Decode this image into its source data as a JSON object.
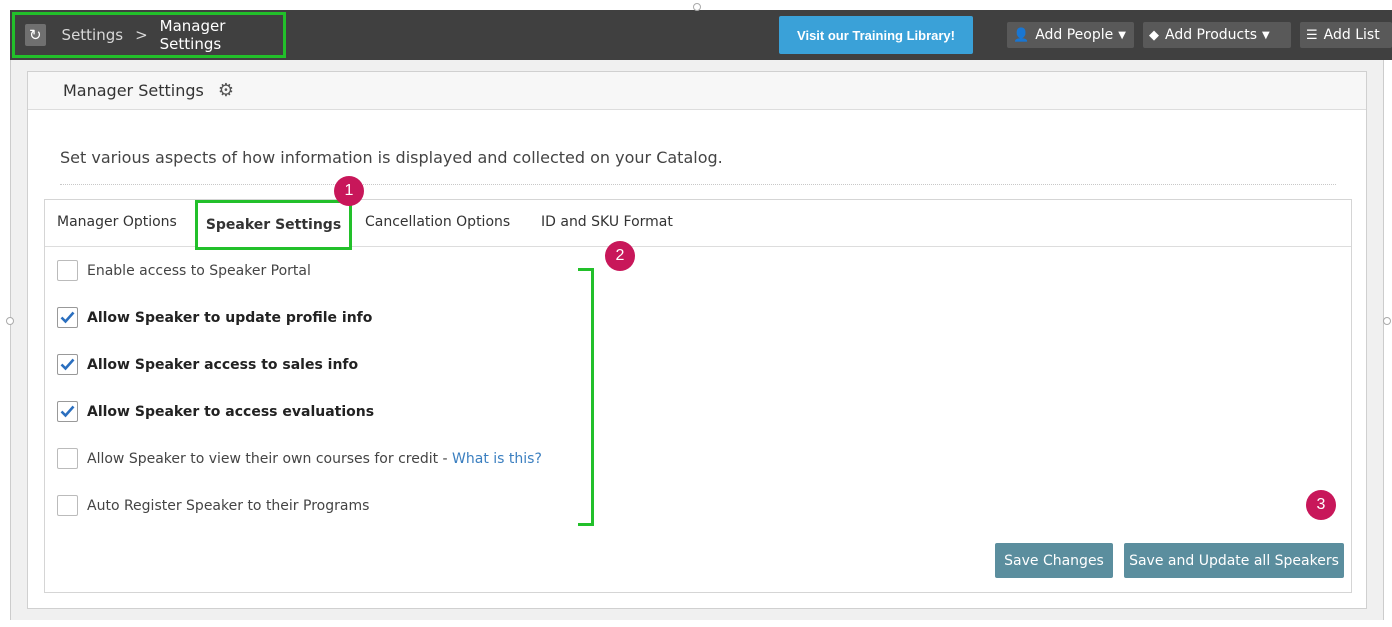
{
  "topbar": {
    "breadcrumb": {
      "refresh_icon": "refresh-icon",
      "root": "Settings",
      "separator": ">",
      "current": "Manager Settings"
    },
    "training_button": "Visit our Training Library!",
    "add_people": "Add People",
    "add_products": "Add Products",
    "add_list": "Add List"
  },
  "panel": {
    "title": "Manager Settings",
    "description": "Set various aspects of how information is displayed and collected on your Catalog."
  },
  "tabs": [
    {
      "label": "Manager Options",
      "active": false
    },
    {
      "label": "Speaker Settings",
      "active": true
    },
    {
      "label": "Cancellation Options",
      "active": false
    },
    {
      "label": "ID and SKU Format",
      "active": false
    }
  ],
  "options": [
    {
      "label": "Enable access to Speaker Portal",
      "checked": false
    },
    {
      "label": "Allow Speaker to update profile info",
      "checked": true
    },
    {
      "label": "Allow Speaker access to sales info",
      "checked": true
    },
    {
      "label": "Allow Speaker to access evaluations",
      "checked": true
    },
    {
      "label": "Allow Speaker to view their own courses for credit - ",
      "link": "What is this?",
      "checked": false
    },
    {
      "label": "Auto Register Speaker to their Programs",
      "checked": false
    }
  ],
  "buttons": {
    "save_changes": "Save Changes",
    "save_update_all": "Save and Update all Speakers"
  },
  "markers": [
    "1",
    "2",
    "3"
  ],
  "colors": {
    "highlight": "#22c02a",
    "marker": "#c8175a",
    "topbar": "#404040",
    "training_button": "#3aa1d8",
    "save_button": "#5b8e9e",
    "link": "#3b7fc0"
  }
}
